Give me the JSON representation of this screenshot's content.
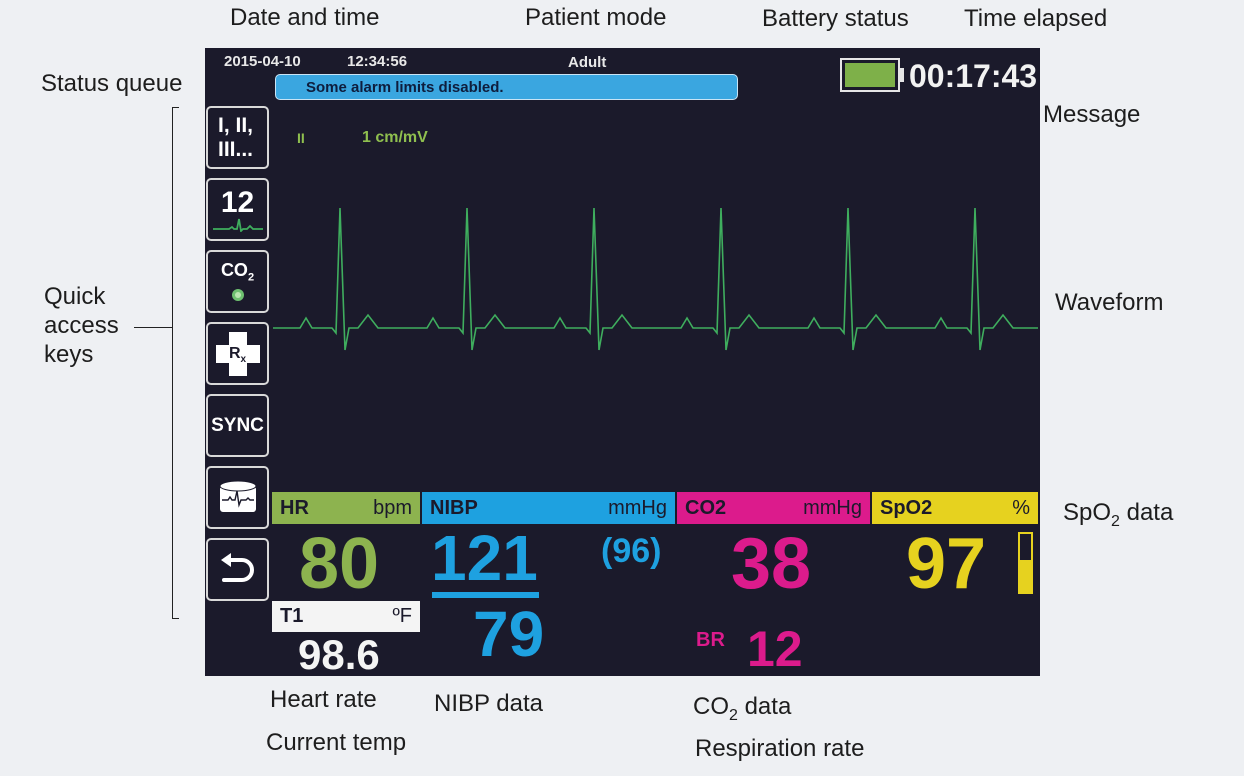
{
  "callouts": {
    "date_time": "Date and time",
    "patient_mode": "Patient mode",
    "battery_status": "Battery status",
    "time_elapsed": "Time elapsed",
    "status_queue": "Status queue",
    "message": "Message",
    "quick_access_1": "Quick",
    "quick_access_2": "access",
    "quick_access_3": "keys",
    "waveform": "Waveform",
    "spo2_data_pre": "SpO",
    "spo2_data_sub": "2",
    "spo2_data_post": " data",
    "heart_rate": "Heart rate",
    "current_temp": "Current temp",
    "nibp_data": "NIBP data",
    "co2_data_pre": "CO",
    "co2_data_sub": "2",
    "co2_data_post": " data",
    "respiration_rate": "Respiration rate"
  },
  "status": {
    "date": "2015-04-10",
    "time": "12:34:56",
    "patient_mode": "Adult",
    "message": "Some alarm limits disabled.",
    "elapsed": "00:17:43",
    "battery_level": 1.0
  },
  "quick_keys": {
    "leads_line1": "I, II,",
    "leads_line2": "III...",
    "twelve_lead": "12",
    "co2": "CO",
    "co2_sub": "2",
    "rx": "R",
    "rx_sub": "x",
    "sync": "SYNC"
  },
  "waveform": {
    "lead": "II",
    "scale": "1 cm/mV"
  },
  "params": {
    "hr": {
      "label": "HR",
      "unit": "bpm",
      "value": "80"
    },
    "nibp": {
      "label": "NIBP",
      "unit": "mmHg",
      "systolic": "121",
      "diastolic": "79",
      "mean": "(96)"
    },
    "co2": {
      "label": "CO2",
      "unit": "mmHg",
      "value": "38",
      "br_label": "BR",
      "br_value": "12"
    },
    "spo2": {
      "label": "SpO2",
      "unit": "%",
      "value": "97",
      "bar_level": 0.55
    },
    "temp": {
      "label": "T1",
      "unit": "ºF",
      "value": "98.6"
    }
  },
  "colors": {
    "screen_bg": "#1b1a2b",
    "hr": "#8db34f",
    "nibp": "#1ea1e0",
    "co2": "#dc1b8c",
    "spo2": "#e6d21f",
    "waveform": "#3fae5e"
  }
}
